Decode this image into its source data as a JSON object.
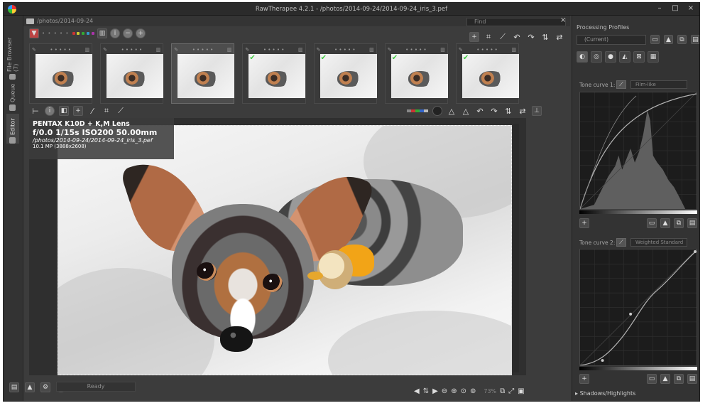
{
  "window": {
    "title": "RawTherapee 4.2.1 - /photos/2014-09-24/2014-09-24_iris_3.pef",
    "controls": [
      "–",
      "□",
      "×"
    ]
  },
  "side_tabs": {
    "file_browser": "File Browser (7)",
    "queue": "Queue",
    "editor": "Editor"
  },
  "file_browser": {
    "path": "/photos/2014-09-24",
    "find_placeholder": "Find",
    "close": "×"
  },
  "thumbnails": [
    {
      "rating": "• • • • •",
      "selected": false,
      "checked": false
    },
    {
      "rating": "• • • • •",
      "selected": false,
      "checked": false
    },
    {
      "rating": "• • • • •",
      "selected": true,
      "checked": false
    },
    {
      "rating": "• • • • •",
      "selected": false,
      "checked": true
    },
    {
      "rating": "• • • • •",
      "selected": false,
      "checked": true
    },
    {
      "rating": "• • • • •",
      "selected": false,
      "checked": true
    },
    {
      "rating": "• • • • •",
      "selected": false,
      "checked": true
    }
  ],
  "info_overlay": {
    "camera": "PENTAX K10D + K,M Lens",
    "exposure": "f/0.0  1/15s  ISO200  50.00mm",
    "file": "/photos/2014-09-24/2014-09-24_iris_3.pef",
    "megapixels": "10.1 MP (3888x2608)"
  },
  "status": {
    "text": "Ready",
    "zoom": "73%"
  },
  "right_panel": {
    "title": "Processing Profiles",
    "profile_value": "(Current)",
    "tone_curve_1": {
      "label": "Tone curve 1:",
      "mode": "Film-like"
    },
    "tone_curve_2": {
      "label": "Tone curve 2:",
      "mode": "Weighted Standard"
    },
    "expander": "Shadows/Highlights"
  },
  "colors": {
    "accent_check": "#44cc44",
    "panel_bg": "#3c3c3c",
    "dark_bg": "#2b2b2b"
  }
}
